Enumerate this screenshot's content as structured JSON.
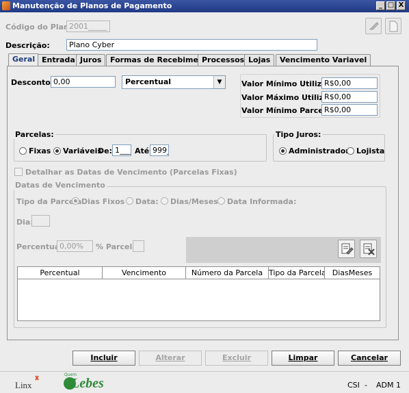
{
  "window": {
    "title": "Manutenção de Planos de Pagamento",
    "minimize": "_",
    "maximize": "□",
    "close": "X"
  },
  "header": {
    "codigo_label": "Código do Plano:",
    "codigo_value": "2001_____",
    "descricao_label": "Descrição:",
    "descricao_value": "Plano Cyber"
  },
  "tabs": [
    {
      "label": "Geral"
    },
    {
      "label": "Entrada"
    },
    {
      "label": "Juros"
    },
    {
      "label": "Formas de Recebimento"
    },
    {
      "label": "Processos"
    },
    {
      "label": "Lojas"
    },
    {
      "label": "Vencimento Variavel"
    }
  ],
  "geral": {
    "desconto_label": "Desconto:",
    "desconto_value": "0,00",
    "tipo_desconto": "Percentual",
    "valor_min_utilizacao_label": "Valor Mínimo Utilização:",
    "valor_min_utilizacao": "R$0,00",
    "valor_max_utilizacao_label": "Valor Máximo Utilização:",
    "valor_max_utilizacao": "R$0,00",
    "valor_min_parcela_label": "Valor Mínimo Parcela:",
    "valor_min_parcela": "R$0,00",
    "parcelas": {
      "title": "Parcelas:",
      "fixas": "Fixas",
      "variaveis": "Variáveis",
      "selected": "Variáveis",
      "de_label": "De:",
      "de_value": "1___",
      "ate_label": "Até:",
      "ate_value": "999_"
    },
    "tipo_juros": {
      "title": "Tipo Juros:",
      "administradora": "Administradora",
      "lojista": "Lojista",
      "selected": "Administradora"
    },
    "detalhar_label": "Detalhar as Datas de Vencimento (Parcelas Fixas)",
    "datas_vencimento": {
      "title": "Datas de Vencimento",
      "tipo_parcela_label": "Tipo da Parcela",
      "opt_dias_fixos": "Dias Fixos :",
      "opt_data": "Data:",
      "opt_dias_meses": "Dias/Meses",
      "opt_data_informada": "Data Informada:",
      "dia_label": "Dia:",
      "percentual_label": "Percentual:",
      "percentual_value": "0,00%",
      "pct_parcela_label": "% Parcela:"
    },
    "table_columns": [
      "Percentual",
      "Vencimento",
      "Número da Parcela",
      "Tipo da Parcela",
      "DiasMeses"
    ]
  },
  "buttons": {
    "incluir": "Incluir",
    "alterar": "Alterar",
    "excluir": "Excluir",
    "limpar": "Limpar",
    "cancelar": "Cancelar"
  },
  "status": {
    "linx": "Linx",
    "lebes": "Lebes",
    "lebes_small": "Quem",
    "csi": "CSI",
    "sep": "-",
    "user": "ADM 1"
  }
}
